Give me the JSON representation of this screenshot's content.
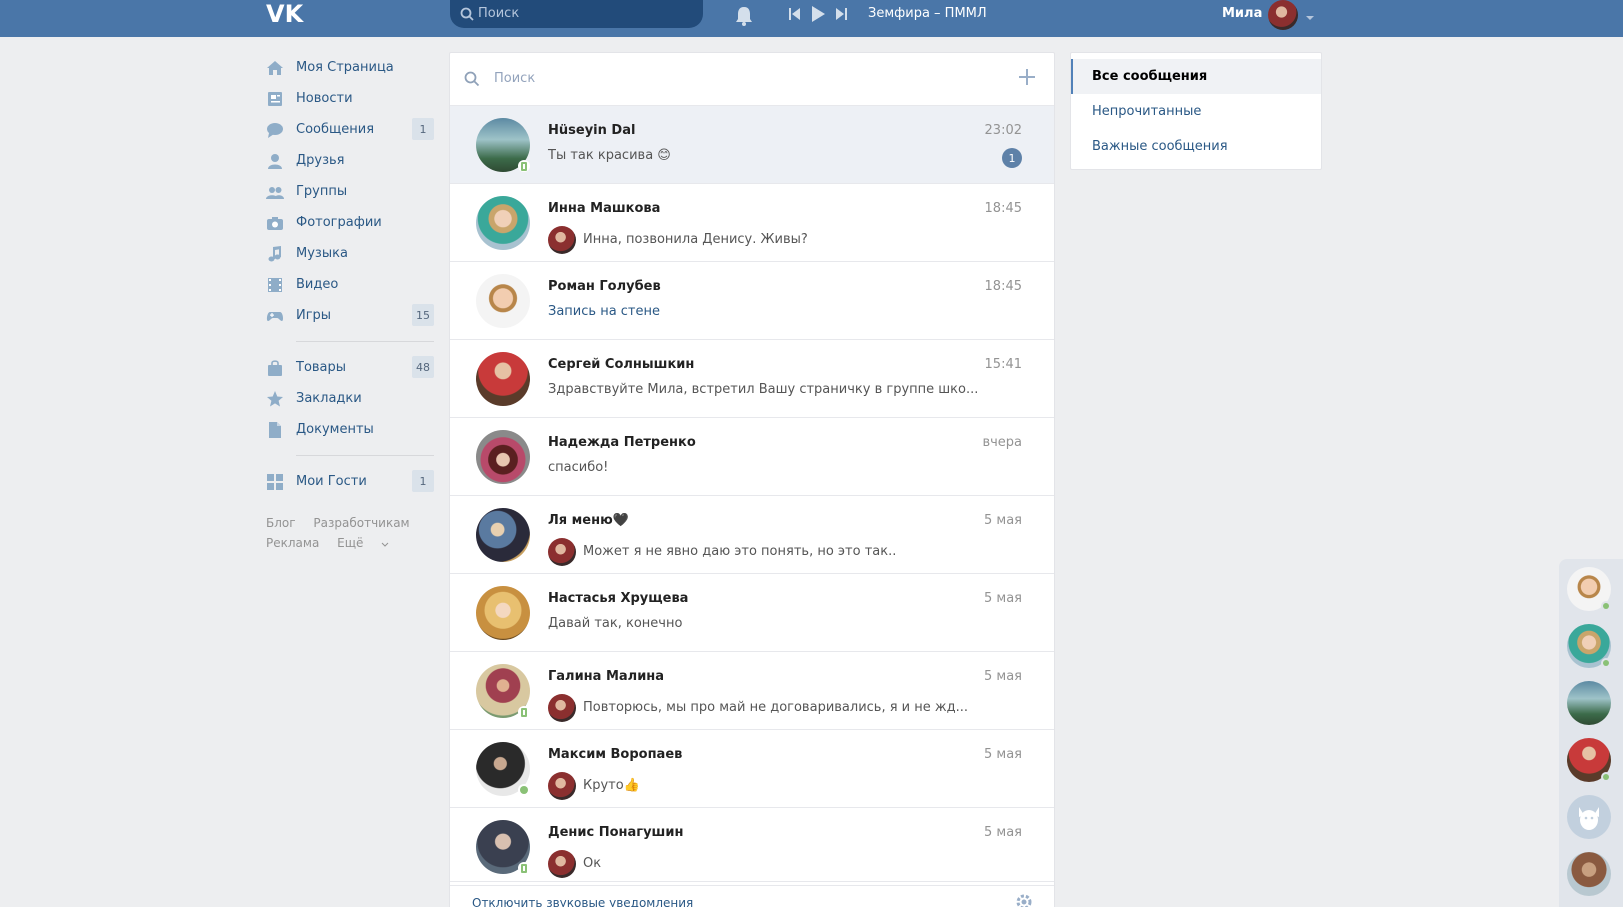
{
  "header": {
    "logo": "VK",
    "search_placeholder": "Поиск",
    "now_playing": "Земфира – ПММЛ",
    "user_name": "Мила"
  },
  "nav": {
    "items": [
      {
        "label": "Моя Страница",
        "icon": "home-icon"
      },
      {
        "label": "Новости",
        "icon": "news-icon"
      },
      {
        "label": "Сообщения",
        "icon": "messages-icon",
        "count": "1"
      },
      {
        "label": "Друзья",
        "icon": "friends-icon"
      },
      {
        "label": "Группы",
        "icon": "groups-icon"
      },
      {
        "label": "Фотографии",
        "icon": "camera-icon"
      },
      {
        "label": "Музыка",
        "icon": "music-icon"
      },
      {
        "label": "Видео",
        "icon": "video-icon"
      },
      {
        "label": "Игры",
        "icon": "games-icon",
        "count": "15"
      },
      {
        "label": "Товары",
        "icon": "bag-icon",
        "count": "48"
      },
      {
        "label": "Закладки",
        "icon": "star-icon"
      },
      {
        "label": "Документы",
        "icon": "document-icon"
      },
      {
        "label": "Мои Гости",
        "icon": "apps-icon",
        "count": "1"
      }
    ],
    "footer": {
      "blog": "Блог",
      "devs": "Разработчикам",
      "ads": "Реклама",
      "more": "Ещё"
    }
  },
  "dialogs": {
    "search_placeholder": "Поиск",
    "items": [
      {
        "name": "Hüseyin Dal",
        "time": "23:02",
        "text": "Ты так красива 😊",
        "unread": "1"
      },
      {
        "name": "Инна Машкова",
        "time": "18:45",
        "text": "Инна, позвонила Денису. Живы?"
      },
      {
        "name": "Роман Голубев",
        "time": "18:45",
        "text": "Запись на стене"
      },
      {
        "name": "Сергей Солнышкин",
        "time": "15:41",
        "text": "Здравствуйте Мила, встретил Вашу страничку в группе шко..."
      },
      {
        "name": "Надежда Петренко",
        "time": "вчера",
        "text": "спасибо!"
      },
      {
        "name": "Ля меню🖤",
        "time": "5 мая",
        "text": "Может я не явно даю это понять, но это так.."
      },
      {
        "name": "Настасья Хрущева",
        "time": "5 мая",
        "text": "Давай так, конечно"
      },
      {
        "name": "Галина Малина",
        "time": "5 мая",
        "text": "Повторюсь, мы про май не договаривались, я и не жд..."
      },
      {
        "name": "Максим Воропаев",
        "time": "5 мая",
        "text": "Круто👍"
      },
      {
        "name": "Денис Понагушин",
        "time": "5 мая",
        "text": "Ок"
      }
    ],
    "footer_text": "Отключить звуковые уведомления"
  },
  "filter": {
    "all": "Все сообщения",
    "unread": "Непрочитанные",
    "important": "Важные сообщения"
  }
}
